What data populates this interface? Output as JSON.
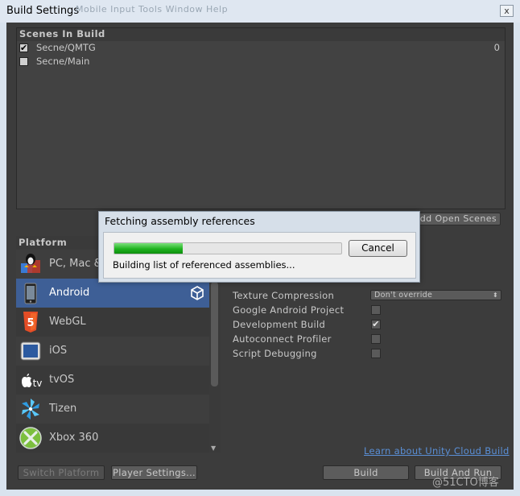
{
  "window": {
    "title": "Build Settings",
    "menu_ghost": "Mobile Input   Tools   Window   Help",
    "close_glyph": "x"
  },
  "scenes": {
    "header": "Scenes In Build",
    "items": [
      {
        "name": "Secne/QMTG",
        "checked": "✔",
        "index": "0"
      },
      {
        "name": "Secne/Main",
        "checked": "",
        "index": ""
      }
    ],
    "add_open_scenes": "Add Open Scenes"
  },
  "platform": {
    "header": "Platform",
    "items": [
      {
        "label": "PC, Mac & Linux Standalone",
        "icon": "pc-mac-linux-icon"
      },
      {
        "label": "Android",
        "icon": "android-icon",
        "selected": true
      },
      {
        "label": "WebGL",
        "icon": "html5-icon"
      },
      {
        "label": "iOS",
        "icon": "ios-device-icon"
      },
      {
        "label": "tvOS",
        "icon": "apple-tv-icon"
      },
      {
        "label": "Tizen",
        "icon": "tizen-icon"
      },
      {
        "label": "Xbox 360",
        "icon": "xbox-icon"
      }
    ]
  },
  "settings": {
    "texture_compression_label": "Texture Compression",
    "texture_compression_value": "Don't override",
    "google_android_project": "Google Android Project",
    "development_build": "Development Build",
    "development_build_check": "✔",
    "autoconnect_profiler": "Autoconnect Profiler",
    "script_debugging": "Script Debugging"
  },
  "links": {
    "cloud_build": "Learn about Unity Cloud Build"
  },
  "buttons": {
    "switch_platform": "Switch Platform",
    "player_settings": "Player Settings...",
    "build": "Build",
    "build_and_run": "Build And Run"
  },
  "dialog": {
    "title": "Fetching assembly references",
    "progress": 0.3,
    "cancel": "Cancel",
    "status": "Building list of referenced assemblies..."
  },
  "watermark": "@51CTO博客",
  "colors": {
    "selected": "#3e5f96",
    "link": "#5a8fd6",
    "progress": "#1fb31f"
  }
}
